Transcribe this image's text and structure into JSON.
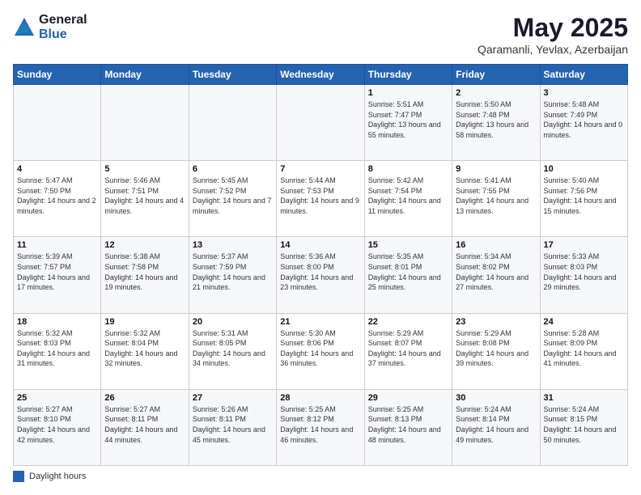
{
  "logo": {
    "general": "General",
    "blue": "Blue"
  },
  "header": {
    "month_year": "May 2025",
    "location": "Qaramanli, Yevlax, Azerbaijan"
  },
  "weekdays": [
    "Sunday",
    "Monday",
    "Tuesday",
    "Wednesday",
    "Thursday",
    "Friday",
    "Saturday"
  ],
  "footer": {
    "legend_label": "Daylight hours"
  },
  "weeks": [
    [
      {
        "day": "",
        "sunrise": "",
        "sunset": "",
        "daylight": "",
        "empty": true
      },
      {
        "day": "",
        "sunrise": "",
        "sunset": "",
        "daylight": "",
        "empty": true
      },
      {
        "day": "",
        "sunrise": "",
        "sunset": "",
        "daylight": "",
        "empty": true
      },
      {
        "day": "",
        "sunrise": "",
        "sunset": "",
        "daylight": "",
        "empty": true
      },
      {
        "day": "1",
        "sunrise": "Sunrise: 5:51 AM",
        "sunset": "Sunset: 7:47 PM",
        "daylight": "Daylight: 13 hours and 55 minutes.",
        "empty": false
      },
      {
        "day": "2",
        "sunrise": "Sunrise: 5:50 AM",
        "sunset": "Sunset: 7:48 PM",
        "daylight": "Daylight: 13 hours and 58 minutes.",
        "empty": false
      },
      {
        "day": "3",
        "sunrise": "Sunrise: 5:48 AM",
        "sunset": "Sunset: 7:49 PM",
        "daylight": "Daylight: 14 hours and 0 minutes.",
        "empty": false
      }
    ],
    [
      {
        "day": "4",
        "sunrise": "Sunrise: 5:47 AM",
        "sunset": "Sunset: 7:50 PM",
        "daylight": "Daylight: 14 hours and 2 minutes.",
        "empty": false
      },
      {
        "day": "5",
        "sunrise": "Sunrise: 5:46 AM",
        "sunset": "Sunset: 7:51 PM",
        "daylight": "Daylight: 14 hours and 4 minutes.",
        "empty": false
      },
      {
        "day": "6",
        "sunrise": "Sunrise: 5:45 AM",
        "sunset": "Sunset: 7:52 PM",
        "daylight": "Daylight: 14 hours and 7 minutes.",
        "empty": false
      },
      {
        "day": "7",
        "sunrise": "Sunrise: 5:44 AM",
        "sunset": "Sunset: 7:53 PM",
        "daylight": "Daylight: 14 hours and 9 minutes.",
        "empty": false
      },
      {
        "day": "8",
        "sunrise": "Sunrise: 5:42 AM",
        "sunset": "Sunset: 7:54 PM",
        "daylight": "Daylight: 14 hours and 11 minutes.",
        "empty": false
      },
      {
        "day": "9",
        "sunrise": "Sunrise: 5:41 AM",
        "sunset": "Sunset: 7:55 PM",
        "daylight": "Daylight: 14 hours and 13 minutes.",
        "empty": false
      },
      {
        "day": "10",
        "sunrise": "Sunrise: 5:40 AM",
        "sunset": "Sunset: 7:56 PM",
        "daylight": "Daylight: 14 hours and 15 minutes.",
        "empty": false
      }
    ],
    [
      {
        "day": "11",
        "sunrise": "Sunrise: 5:39 AM",
        "sunset": "Sunset: 7:57 PM",
        "daylight": "Daylight: 14 hours and 17 minutes.",
        "empty": false
      },
      {
        "day": "12",
        "sunrise": "Sunrise: 5:38 AM",
        "sunset": "Sunset: 7:58 PM",
        "daylight": "Daylight: 14 hours and 19 minutes.",
        "empty": false
      },
      {
        "day": "13",
        "sunrise": "Sunrise: 5:37 AM",
        "sunset": "Sunset: 7:59 PM",
        "daylight": "Daylight: 14 hours and 21 minutes.",
        "empty": false
      },
      {
        "day": "14",
        "sunrise": "Sunrise: 5:36 AM",
        "sunset": "Sunset: 8:00 PM",
        "daylight": "Daylight: 14 hours and 23 minutes.",
        "empty": false
      },
      {
        "day": "15",
        "sunrise": "Sunrise: 5:35 AM",
        "sunset": "Sunset: 8:01 PM",
        "daylight": "Daylight: 14 hours and 25 minutes.",
        "empty": false
      },
      {
        "day": "16",
        "sunrise": "Sunrise: 5:34 AM",
        "sunset": "Sunset: 8:02 PM",
        "daylight": "Daylight: 14 hours and 27 minutes.",
        "empty": false
      },
      {
        "day": "17",
        "sunrise": "Sunrise: 5:33 AM",
        "sunset": "Sunset: 8:03 PM",
        "daylight": "Daylight: 14 hours and 29 minutes.",
        "empty": false
      }
    ],
    [
      {
        "day": "18",
        "sunrise": "Sunrise: 5:32 AM",
        "sunset": "Sunset: 8:03 PM",
        "daylight": "Daylight: 14 hours and 31 minutes.",
        "empty": false
      },
      {
        "day": "19",
        "sunrise": "Sunrise: 5:32 AM",
        "sunset": "Sunset: 8:04 PM",
        "daylight": "Daylight: 14 hours and 32 minutes.",
        "empty": false
      },
      {
        "day": "20",
        "sunrise": "Sunrise: 5:31 AM",
        "sunset": "Sunset: 8:05 PM",
        "daylight": "Daylight: 14 hours and 34 minutes.",
        "empty": false
      },
      {
        "day": "21",
        "sunrise": "Sunrise: 5:30 AM",
        "sunset": "Sunset: 8:06 PM",
        "daylight": "Daylight: 14 hours and 36 minutes.",
        "empty": false
      },
      {
        "day": "22",
        "sunrise": "Sunrise: 5:29 AM",
        "sunset": "Sunset: 8:07 PM",
        "daylight": "Daylight: 14 hours and 37 minutes.",
        "empty": false
      },
      {
        "day": "23",
        "sunrise": "Sunrise: 5:29 AM",
        "sunset": "Sunset: 8:08 PM",
        "daylight": "Daylight: 14 hours and 39 minutes.",
        "empty": false
      },
      {
        "day": "24",
        "sunrise": "Sunrise: 5:28 AM",
        "sunset": "Sunset: 8:09 PM",
        "daylight": "Daylight: 14 hours and 41 minutes.",
        "empty": false
      }
    ],
    [
      {
        "day": "25",
        "sunrise": "Sunrise: 5:27 AM",
        "sunset": "Sunset: 8:10 PM",
        "daylight": "Daylight: 14 hours and 42 minutes.",
        "empty": false
      },
      {
        "day": "26",
        "sunrise": "Sunrise: 5:27 AM",
        "sunset": "Sunset: 8:11 PM",
        "daylight": "Daylight: 14 hours and 44 minutes.",
        "empty": false
      },
      {
        "day": "27",
        "sunrise": "Sunrise: 5:26 AM",
        "sunset": "Sunset: 8:11 PM",
        "daylight": "Daylight: 14 hours and 45 minutes.",
        "empty": false
      },
      {
        "day": "28",
        "sunrise": "Sunrise: 5:25 AM",
        "sunset": "Sunset: 8:12 PM",
        "daylight": "Daylight: 14 hours and 46 minutes.",
        "empty": false
      },
      {
        "day": "29",
        "sunrise": "Sunrise: 5:25 AM",
        "sunset": "Sunset: 8:13 PM",
        "daylight": "Daylight: 14 hours and 48 minutes.",
        "empty": false
      },
      {
        "day": "30",
        "sunrise": "Sunrise: 5:24 AM",
        "sunset": "Sunset: 8:14 PM",
        "daylight": "Daylight: 14 hours and 49 minutes.",
        "empty": false
      },
      {
        "day": "31",
        "sunrise": "Sunrise: 5:24 AM",
        "sunset": "Sunset: 8:15 PM",
        "daylight": "Daylight: 14 hours and 50 minutes.",
        "empty": false
      }
    ]
  ]
}
